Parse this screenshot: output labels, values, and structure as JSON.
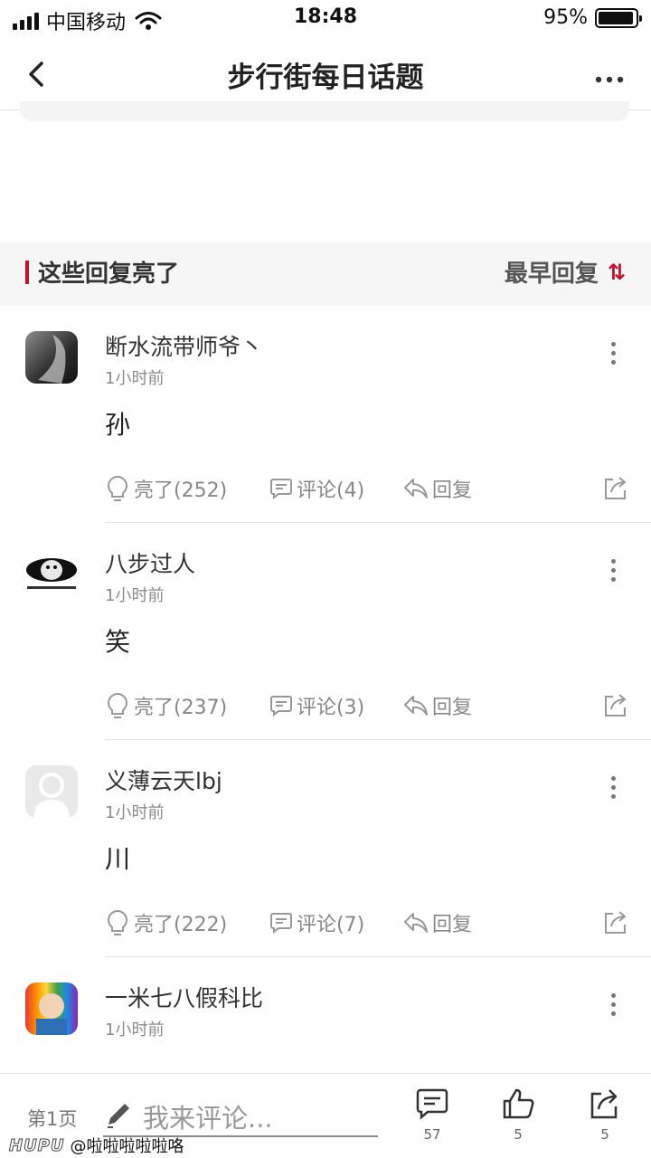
{
  "status_bar": {
    "carrier": "中国移动",
    "time": "18:48",
    "battery": "95%",
    "battery_level": 0.95
  },
  "nav": {
    "title": "步行街每日话题"
  },
  "section": {
    "label": "这些回复亮了",
    "sort_label": "最早回复",
    "sort_icon": "⇅"
  },
  "comments": [
    {
      "name": "断水流带师爷丶",
      "time": "1小时前",
      "text": "孙",
      "light": "亮了(252)",
      "comment": "评论(4)",
      "reply": "回复"
    },
    {
      "name": "八步过人",
      "time": "1小时前",
      "text": "笑",
      "light": "亮了(237)",
      "comment": "评论(3)",
      "reply": "回复"
    },
    {
      "name": "义薄云天lbj",
      "time": "1小时前",
      "text": "川",
      "light": "亮了(222)",
      "comment": "评论(7)",
      "reply": "回复"
    },
    {
      "name": "一米七八假科比",
      "time": "1小时前",
      "text": "",
      "light": "",
      "comment": "",
      "reply": ""
    }
  ],
  "bottom_bar": {
    "page": "第1页",
    "input_placeholder": "我来评论...",
    "comment_count": "57",
    "like_count": "5",
    "share_count": "5"
  },
  "watermark": {
    "brand": "HUPU",
    "handle": "@啦啦啦啦啦咯"
  },
  "colors": {
    "accent": "#c8102e"
  }
}
